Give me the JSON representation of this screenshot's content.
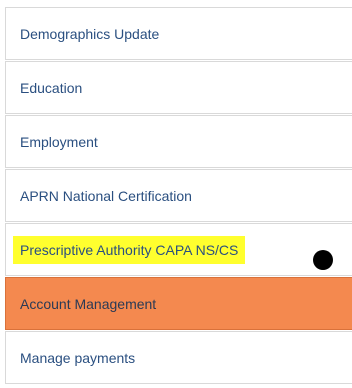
{
  "menu": {
    "items": [
      {
        "label": "Demographics Update"
      },
      {
        "label": "Education"
      },
      {
        "label": "Employment"
      },
      {
        "label": "APRN National Certification"
      },
      {
        "label": "Prescriptive Authority CAPA NS/CS",
        "highlighted": true
      },
      {
        "label": "Account Management",
        "active": true
      },
      {
        "label": "Manage payments"
      }
    ]
  },
  "colors": {
    "link_text": "#2a4f80",
    "highlight": "#ffff2e",
    "active_bg": "#f4894f",
    "border": "#d9d9d9"
  }
}
